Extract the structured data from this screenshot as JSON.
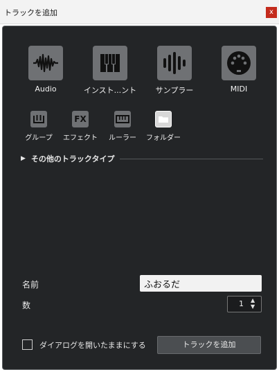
{
  "window": {
    "title": "トラックを追加",
    "close_label": "x"
  },
  "main_types": [
    {
      "label": "Audio",
      "icon": "audio-waveform-icon"
    },
    {
      "label": "インスト...ント",
      "icon": "piano-keys-icon"
    },
    {
      "label": "サンプラー",
      "icon": "sampler-bars-icon"
    },
    {
      "label": "MIDI",
      "icon": "midi-connector-icon"
    }
  ],
  "secondary_types": [
    {
      "label": "グループ",
      "icon": "group-faders-icon"
    },
    {
      "label": "エフェクト",
      "icon": "fx-icon",
      "icon_text": "FX"
    },
    {
      "label": "ルーラー",
      "icon": "ruler-icon"
    },
    {
      "label": "フォルダー",
      "icon": "folder-icon"
    }
  ],
  "other_types": {
    "arrow": "▶",
    "label": "その他のトラックタイプ"
  },
  "form": {
    "name_label": "名前",
    "name_value": "ふおるだ",
    "count_label": "数",
    "count_value": "1"
  },
  "footer": {
    "keep_open_label": "ダイアログを開いたままにする",
    "add_button_label": "トラックを追加"
  },
  "colors": {
    "panel_bg": "#232527",
    "icon_bg": "#6f7174",
    "active_icon_bg": "#d8d8d8",
    "close_bg": "#c42b1c"
  }
}
